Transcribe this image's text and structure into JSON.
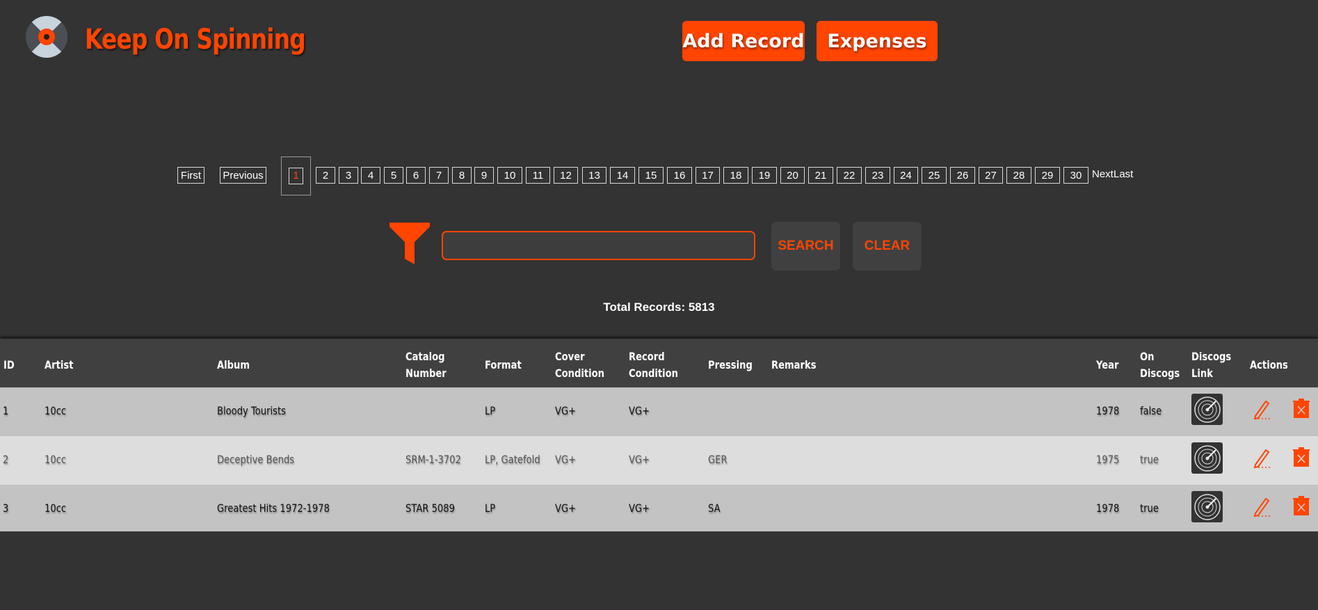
{
  "header": {
    "brand": "Keep On Spinning",
    "add_record_label": "Add Record",
    "expenses_label": "Expenses"
  },
  "pagination": {
    "first": "First",
    "previous": "Previous",
    "pages": [
      "1",
      "2",
      "3",
      "4",
      "5",
      "6",
      "7",
      "8",
      "9",
      "10",
      "11",
      "12",
      "13",
      "14",
      "15",
      "16",
      "17",
      "18",
      "19",
      "20",
      "21",
      "22",
      "23",
      "24",
      "25",
      "26",
      "27",
      "28",
      "29",
      "30"
    ],
    "current_page": "1",
    "next": "Next",
    "last": "Last"
  },
  "search": {
    "value": "",
    "search_label": "SEARCH",
    "clear_label": "CLEAR"
  },
  "total_records": "Total Records: 5813",
  "table": {
    "headers": {
      "id": "ID",
      "artist": "Artist",
      "album": "Album",
      "catalog_1": "Catalog",
      "catalog_2": "Number",
      "format": "Format",
      "cover_1": "Cover",
      "cover_2": "Condition",
      "record_1": "Record",
      "record_2": "Condition",
      "pressing": "Pressing",
      "remarks": "Remarks",
      "year": "Year",
      "on_discogs_1": "On",
      "on_discogs_2": "Discogs",
      "discogs_link_1": "Discogs",
      "discogs_link_2": "Link",
      "actions": "Actions"
    },
    "rows": [
      {
        "id": "1",
        "artist": "10cc",
        "album": "Bloody Tourists",
        "catalog": "",
        "format": "LP",
        "cover": "VG+",
        "record": "VG+",
        "pressing": "",
        "remarks": "",
        "year": "1978",
        "on_discogs": "false"
      },
      {
        "id": "2",
        "artist": "10cc",
        "album": "Deceptive Bends",
        "catalog": "SRM-1-3702",
        "format": "LP, Gatefold",
        "cover": "VG+",
        "record": "VG+",
        "pressing": "GER",
        "remarks": "",
        "year": "1975",
        "on_discogs": "true"
      },
      {
        "id": "3",
        "artist": "10cc",
        "album": "Greatest Hits 1972-1978",
        "catalog": "STAR 5089",
        "format": "LP",
        "cover": "VG+",
        "record": "VG+",
        "pressing": "SA",
        "remarks": "",
        "year": "1978",
        "on_discogs": "true"
      }
    ]
  },
  "colors": {
    "accent": "#ff4500",
    "background": "#333333",
    "header_row": "#404040",
    "row_dark": "#c3c3c3",
    "row_light": "#dddddd"
  },
  "icons": {
    "logo": "vinyl-record-icon",
    "filter": "funnel-icon",
    "discogs": "vinyl-record-icon",
    "edit": "pencil-icon",
    "delete": "trash-icon"
  }
}
